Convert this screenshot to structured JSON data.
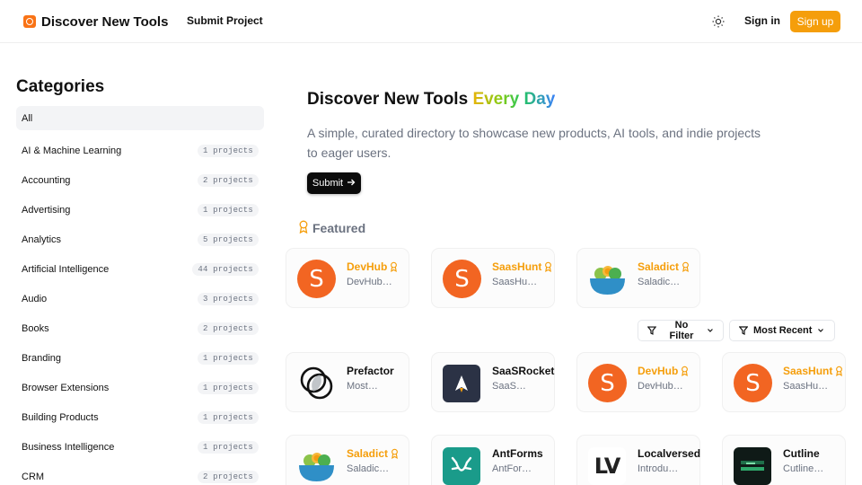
{
  "header": {
    "brand": "Discover New Tools",
    "nav_submit": "Submit Project",
    "sign_in": "Sign in",
    "sign_up": "Sign up"
  },
  "sidebar": {
    "title": "Categories",
    "items": [
      {
        "label": "All",
        "count": ""
      },
      {
        "label": "AI & Machine Learning",
        "count": "1 projects"
      },
      {
        "label": "Accounting",
        "count": "2 projects"
      },
      {
        "label": "Advertising",
        "count": "1 projects"
      },
      {
        "label": "Analytics",
        "count": "5 projects"
      },
      {
        "label": "Artificial Intelligence",
        "count": "44 projects"
      },
      {
        "label": "Audio",
        "count": "3 projects"
      },
      {
        "label": "Books",
        "count": "2 projects"
      },
      {
        "label": "Branding",
        "count": "1 projects"
      },
      {
        "label": "Browser Extensions",
        "count": "1 projects"
      },
      {
        "label": "Building Products",
        "count": "1 projects"
      },
      {
        "label": "Business Intelligence",
        "count": "1 projects"
      },
      {
        "label": "CRM",
        "count": "2 projects"
      }
    ]
  },
  "hero": {
    "title_main": "Discover New Tools",
    "title_accent": "Every Day",
    "subtitle": "A simple, curated directory to showcase new products, AI tools, and indie projects to eager users.",
    "button": "Submit"
  },
  "featured": {
    "label": "Featured",
    "cards": [
      {
        "name": "DevHub",
        "desc": "DevHub…",
        "logo": "S"
      },
      {
        "name": "SaasHunt",
        "desc": "SaasHu…",
        "logo": "S"
      },
      {
        "name": "Saladict",
        "desc": "Saladic…",
        "logo": "salad-bowl"
      }
    ]
  },
  "filters": {
    "no_filter": "No Filter",
    "sort": "Most Recent"
  },
  "projects": [
    {
      "name": "Prefactor",
      "desc": "Most…",
      "featured": false,
      "logo": "prefactor-circles"
    },
    {
      "name": "SaaSRocket",
      "desc": "SaaS…",
      "featured": false,
      "logo": "rocket"
    },
    {
      "name": "DevHub",
      "desc": "DevHub…",
      "featured": true,
      "logo": "S"
    },
    {
      "name": "SaasHunt",
      "desc": "SaasHu…",
      "featured": true,
      "logo": "S"
    },
    {
      "name": "Saladict",
      "desc": "Saladic…",
      "featured": true,
      "logo": "salad-bowl"
    },
    {
      "name": "AntForms",
      "desc": "AntFor…",
      "featured": false,
      "logo": "ant"
    },
    {
      "name": "Localversed",
      "desc": "Introdu…",
      "featured": false,
      "logo": "LV"
    },
    {
      "name": "Cutline",
      "desc": "Cutline…",
      "featured": false,
      "logo": "cutline"
    }
  ],
  "colors": {
    "accent": "#f59e0b",
    "s_logo": "#f26522",
    "antforms": "#1a9b8a",
    "rocket": "#2b3245"
  }
}
